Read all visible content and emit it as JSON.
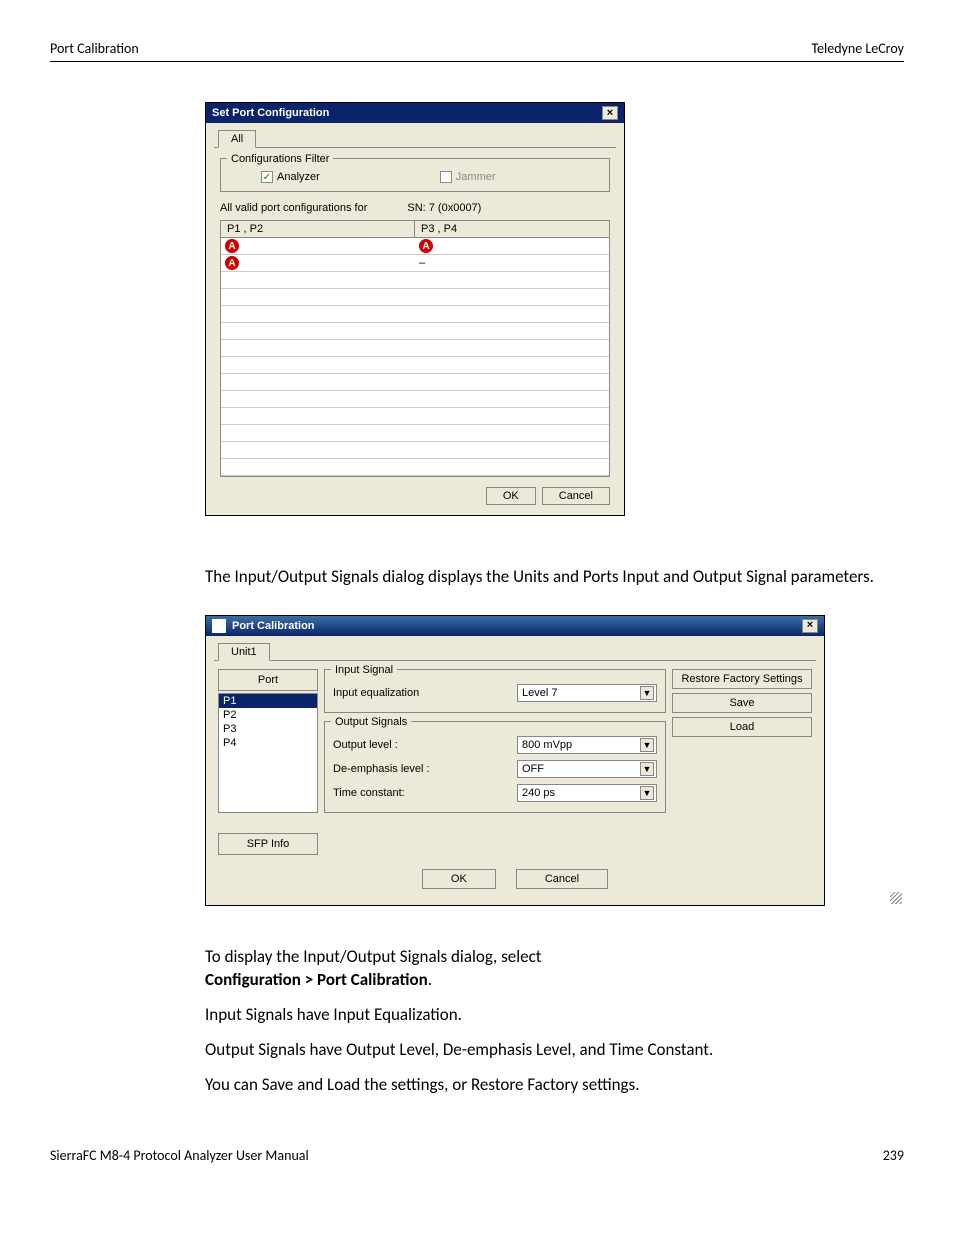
{
  "header": {
    "left": "Port Calibration",
    "right": "Teledyne LeCroy"
  },
  "footer": {
    "left": "SierraFC M8-4 Protocol Analyzer User Manual",
    "right": "239"
  },
  "para1": "The Input/Output Signals dialog displays the Units and Ports Input and Output Signal parameters.",
  "para2a": "To display the Input/Output Signals dialog, select ",
  "para2b": "Configuration > Port Calibration",
  "para2c": ".",
  "para3": "Input Signals have Input Equalization.",
  "para4": "Output Signals have Output Level, De-emphasis Level, and Time Constant.",
  "para5": "You can Save and Load the settings, or Restore Factory settings.",
  "dialog1": {
    "title": "Set Port Configuration",
    "tab": "All",
    "filter_label": "Configurations Filter",
    "analyzer": "Analyzer",
    "jammer": "Jammer",
    "sn_label": "All valid port configurations for",
    "sn_value": "SN: 7 (0x0007)",
    "h1": "P1 , P2",
    "h2": "P3 , P4",
    "ok": "OK",
    "cancel": "Cancel",
    "badge": "A"
  },
  "dialog2": {
    "title": "Port Calibration",
    "tab": "Unit1",
    "port_label": "Port",
    "ports": [
      "P1",
      "P2",
      "P3",
      "P4"
    ],
    "sfp": "SFP Info",
    "input_signal": "Input Signal",
    "input_eq": "Input equalization",
    "input_eq_val": "Level 7",
    "output_signals": "Output Signals",
    "out_level": "Output level :",
    "out_level_val": "800 mVpp",
    "de_emph": "De-emphasis level :",
    "de_emph_val": "OFF",
    "time_const": "Time constant:",
    "time_const_val": "240 ps",
    "restore": "Restore Factory Settings",
    "save": "Save",
    "load": "Load",
    "ok": "OK",
    "cancel": "Cancel"
  }
}
